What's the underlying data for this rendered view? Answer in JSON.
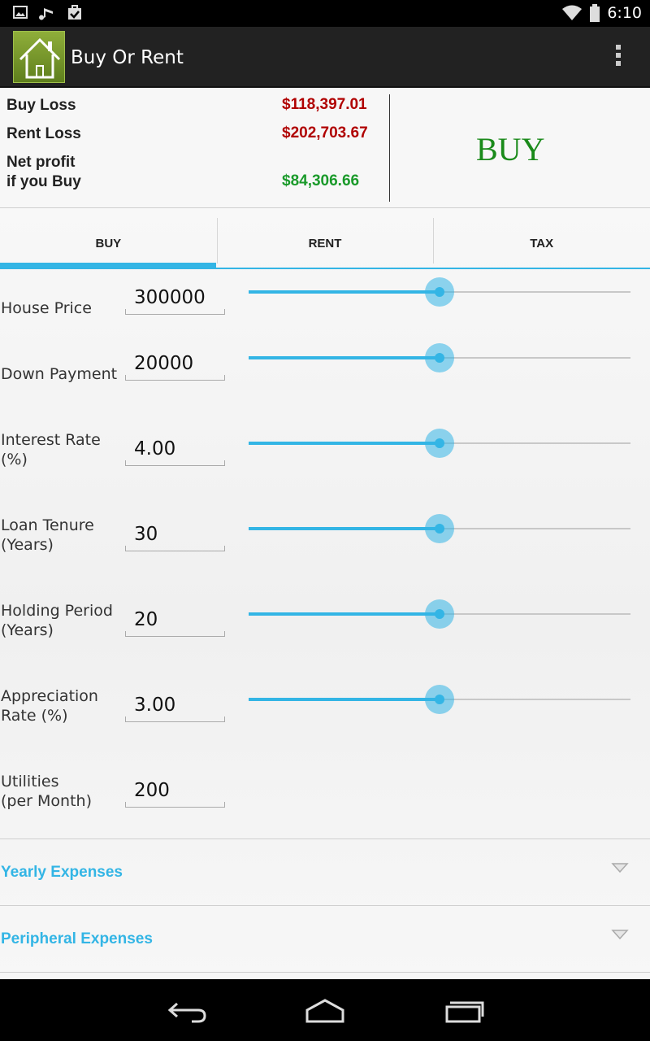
{
  "status_bar": {
    "time": "6:10",
    "icons": [
      "image-icon",
      "music-icon",
      "task-icon",
      "wifi-icon",
      "battery-icon"
    ]
  },
  "app_bar": {
    "title": "Buy Or Rent",
    "icon": "house-icon",
    "menu_icon": "overflow-menu-icon"
  },
  "summary": {
    "buy_loss_label": "Buy Loss",
    "buy_loss_value": "$118,397.01",
    "rent_loss_label": "Rent Loss",
    "rent_loss_value": "$202,703.67",
    "net_profit_label_1": "Net profit",
    "net_profit_label_2": "if you Buy",
    "net_profit_value": "$84,306.66",
    "verdict": "BUY",
    "colors": {
      "loss": "#b00000",
      "profit": "#1a9a2a",
      "verdict": "#1a8a1a"
    }
  },
  "tabs": [
    {
      "label": "BUY",
      "selected": true
    },
    {
      "label": "RENT",
      "selected": false
    },
    {
      "label": "TAX",
      "selected": false
    }
  ],
  "accent_color": "#33b5e5",
  "fields": [
    {
      "label_1": "House Price",
      "label_2": "",
      "value": "300000",
      "slider_position": 0.5
    },
    {
      "label_1": "Down Payment",
      "label_2": "",
      "value": "20000",
      "slider_position": 0.5
    },
    {
      "label_1": "Interest Rate",
      "label_2": "(%)",
      "value": "4.00",
      "slider_position": 0.5
    },
    {
      "label_1": "Loan Tenure",
      "label_2": "(Years)",
      "value": "30",
      "slider_position": 0.5
    },
    {
      "label_1": "Holding Period",
      "label_2": "(Years)",
      "value": "20",
      "slider_position": 0.5
    },
    {
      "label_1": "Appreciation",
      "label_2": "Rate (%)",
      "value": "3.00",
      "slider_position": 0.5
    },
    {
      "label_1": "Utilities",
      "label_2": "(per Month)",
      "value": "200"
    }
  ],
  "sections": [
    {
      "label": "Yearly Expenses",
      "icon": "chevron-down-icon"
    },
    {
      "label": "Peripheral Expenses",
      "icon": "chevron-down-icon"
    }
  ],
  "nav": [
    "back-icon",
    "home-icon",
    "recent-apps-icon"
  ]
}
